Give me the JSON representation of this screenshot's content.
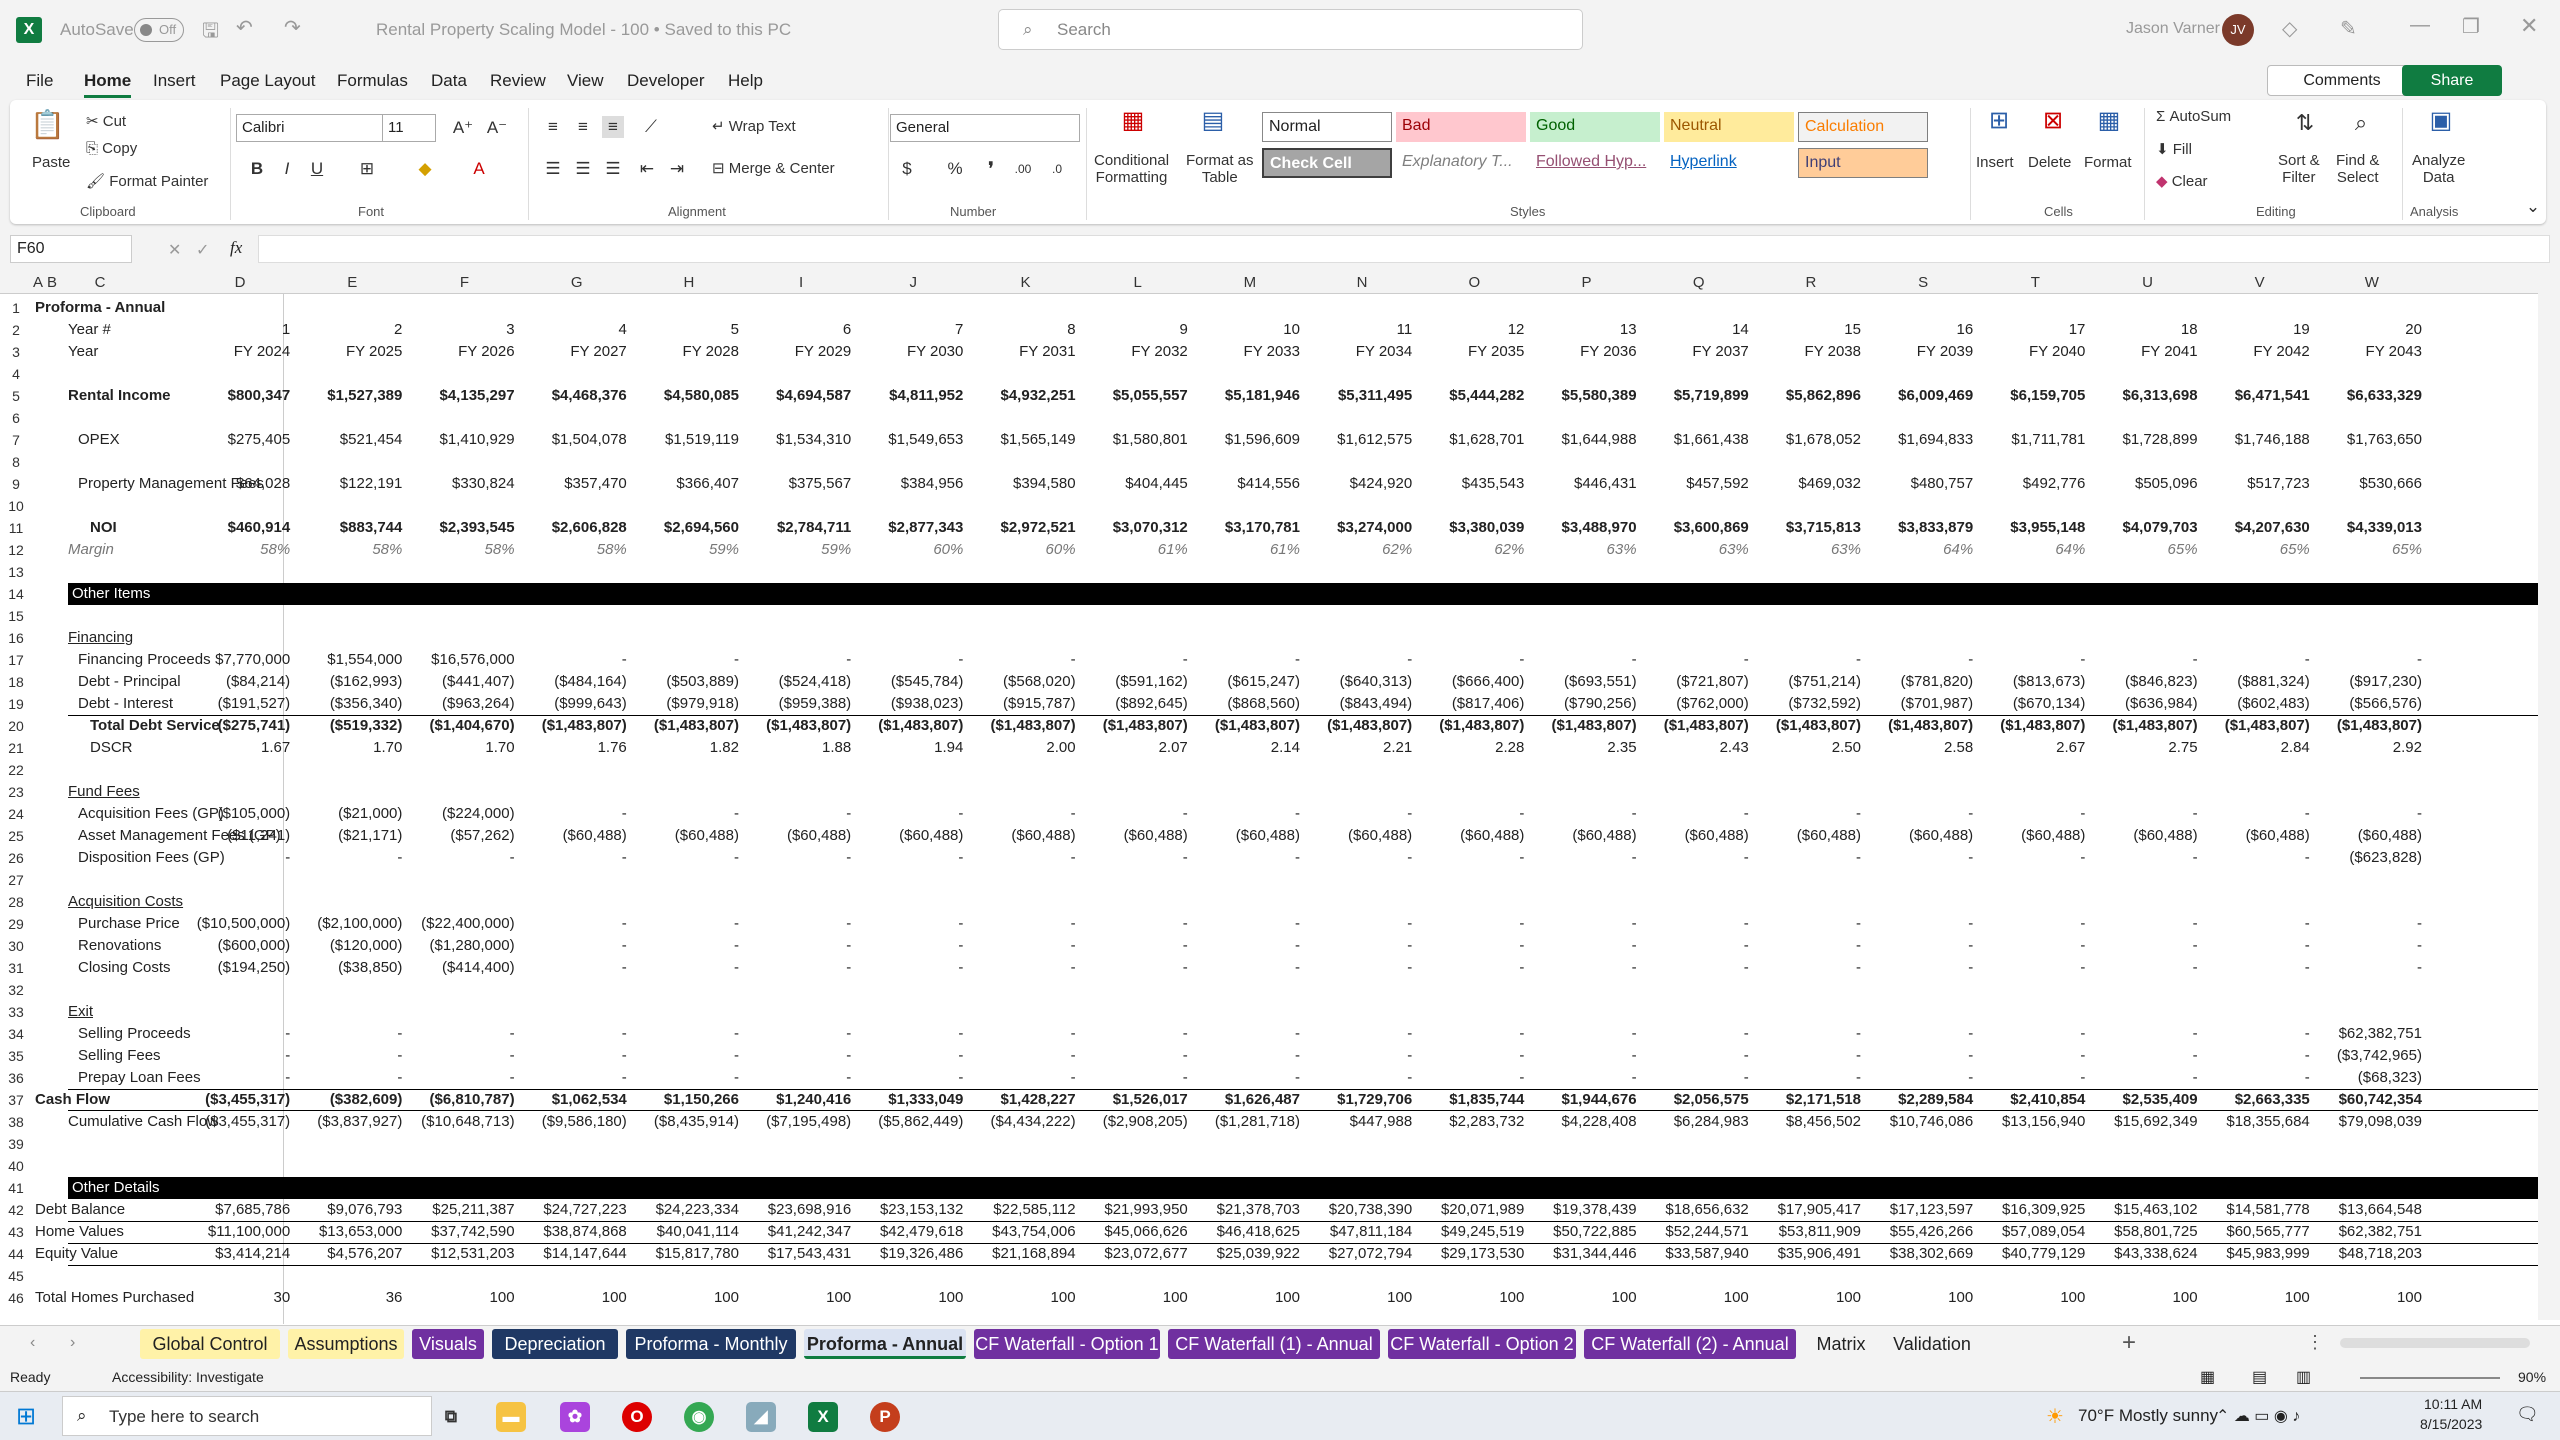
{
  "titlebar": {
    "autosave": "AutoSave",
    "toggle": "Off",
    "doc_title": "Rental Property Scaling Model - 100 • Saved to this PC",
    "search_placeholder": "Search",
    "user_name": "Jason Varner",
    "user_initials": "JV"
  },
  "menu": [
    "File",
    "Home",
    "Insert",
    "Page Layout",
    "Formulas",
    "Data",
    "Review",
    "View",
    "Developer",
    "Help"
  ],
  "menu_active": "Home",
  "comments_label": "Comments",
  "share_label": "Share",
  "ribbon": {
    "paste": "Paste",
    "cut": "Cut",
    "copy": "Copy",
    "format_painter": "Format Painter",
    "clipboard": "Clipboard",
    "font_name": "Calibri",
    "font_size": "11",
    "font": "Font",
    "wrap_text": "Wrap Text",
    "merge_center": "Merge & Center",
    "alignment": "Alignment",
    "number_format": "General",
    "number": "Number",
    "cond_formatting": "Conditional",
    "cond_formatting2": "Formatting",
    "format_table": "Format as",
    "format_table2": "Table",
    "styles": "Styles",
    "style_cells": [
      "Normal",
      "Bad",
      "Good",
      "Neutral",
      "Calculation",
      "Check Cell",
      "Explanatory T...",
      "Followed Hyp...",
      "Hyperlink",
      "Input"
    ],
    "insert": "Insert",
    "delete": "Delete",
    "format": "Format",
    "cells": "Cells",
    "autosum": "AutoSum",
    "fill": "Fill",
    "clear": "Clear",
    "sort_filter": "Sort &",
    "sort_filter2": "Filter",
    "find_select": "Find &",
    "find_select2": "Select",
    "editing": "Editing",
    "analyze": "Analyze",
    "analyze2": "Data",
    "analysis": "Analysis"
  },
  "namebox": "F60",
  "fx": "fx",
  "columns": [
    "A",
    "B",
    "C",
    "D",
    "E",
    "F",
    "G",
    "H",
    "I",
    "J",
    "K",
    "L",
    "M",
    "N",
    "O",
    "P",
    "Q",
    "R",
    "S",
    "T",
    "U",
    "V",
    "W"
  ],
  "rows_numbers": [
    "1",
    "2",
    "3",
    "4",
    "5",
    "6",
    "7",
    "8",
    "9",
    "10",
    "11",
    "12",
    "13",
    "14",
    "15",
    "16",
    "17",
    "18",
    "19",
    "20",
    "21",
    "22",
    "23",
    "24",
    "25",
    "26",
    "27",
    "28",
    "29",
    "30",
    "31",
    "32",
    "33",
    "34",
    "35",
    "36",
    "37",
    "38",
    "39",
    "40",
    "41",
    "42",
    "43",
    "44",
    "45",
    "46"
  ],
  "sheet": {
    "title": "Proforma - Annual",
    "year_label": "Year #",
    "fy_label": "Year",
    "year_nums": [
      "1",
      "2",
      "3",
      "4",
      "5",
      "6",
      "7",
      "8",
      "9",
      "10",
      "11",
      "12",
      "13",
      "14",
      "15",
      "16",
      "17",
      "18",
      "19",
      "20"
    ],
    "fy": [
      "FY 2024",
      "FY 2025",
      "FY 2026",
      "FY 2027",
      "FY 2028",
      "FY 2029",
      "FY 2030",
      "FY 2031",
      "FY 2032",
      "FY 2033",
      "FY 2034",
      "FY 2035",
      "FY 2036",
      "FY 2037",
      "FY 2038",
      "FY 2039",
      "FY 2040",
      "FY 2041",
      "FY 2042",
      "FY 2043"
    ],
    "rows": [
      {
        "r": 5,
        "label": "Rental Income",
        "indent": 1,
        "bold": true,
        "vals": [
          "$800,347",
          "$1,527,389",
          "$4,135,297",
          "$4,468,376",
          "$4,580,085",
          "$4,694,587",
          "$4,811,952",
          "$4,932,251",
          "$5,055,557",
          "$5,181,946",
          "$5,311,495",
          "$5,444,282",
          "$5,580,389",
          "$5,719,899",
          "$5,862,896",
          "$6,009,469",
          "$6,159,705",
          "$6,313,698",
          "$6,471,541",
          "$6,633,329"
        ]
      },
      {
        "r": 7,
        "label": "OPEX",
        "indent": 2,
        "vals": [
          "$275,405",
          "$521,454",
          "$1,410,929",
          "$1,504,078",
          "$1,519,119",
          "$1,534,310",
          "$1,549,653",
          "$1,565,149",
          "$1,580,801",
          "$1,596,609",
          "$1,612,575",
          "$1,628,701",
          "$1,644,988",
          "$1,661,438",
          "$1,678,052",
          "$1,694,833",
          "$1,711,781",
          "$1,728,899",
          "$1,746,188",
          "$1,763,650"
        ]
      },
      {
        "r": 9,
        "label": "Property Management Fees",
        "indent": 2,
        "vals": [
          "$64,028",
          "$122,191",
          "$330,824",
          "$357,470",
          "$366,407",
          "$375,567",
          "$384,956",
          "$394,580",
          "$404,445",
          "$414,556",
          "$424,920",
          "$435,543",
          "$446,431",
          "$457,592",
          "$469,032",
          "$480,757",
          "$492,776",
          "$505,096",
          "$517,723",
          "$530,666"
        ]
      },
      {
        "r": 11,
        "label": "NOI",
        "indent": 3,
        "bold": true,
        "vals": [
          "$460,914",
          "$883,744",
          "$2,393,545",
          "$2,606,828",
          "$2,694,560",
          "$2,784,711",
          "$2,877,343",
          "$2,972,521",
          "$3,070,312",
          "$3,170,781",
          "$3,274,000",
          "$3,380,039",
          "$3,488,970",
          "$3,600,869",
          "$3,715,813",
          "$3,833,879",
          "$3,955,148",
          "$4,079,703",
          "$4,207,630",
          "$4,339,013"
        ]
      },
      {
        "r": 12,
        "label": "Margin",
        "indent": 1,
        "italic": true,
        "vals": [
          "58%",
          "58%",
          "58%",
          "58%",
          "59%",
          "59%",
          "60%",
          "60%",
          "61%",
          "61%",
          "62%",
          "62%",
          "63%",
          "63%",
          "63%",
          "64%",
          "64%",
          "65%",
          "65%",
          "65%"
        ]
      },
      {
        "r": 16,
        "label": "Financing",
        "indent": 1,
        "underline": true,
        "vals": []
      },
      {
        "r": 17,
        "label": "Financing Proceeds",
        "indent": 2,
        "vals": [
          "$7,770,000",
          "$1,554,000",
          "$16,576,000",
          "-",
          "-",
          "-",
          "-",
          "-",
          "-",
          "-",
          "-",
          "-",
          "-",
          "-",
          "-",
          "-",
          "-",
          "-",
          "-",
          "-"
        ]
      },
      {
        "r": 18,
        "label": "Debt - Principal",
        "indent": 2,
        "vals": [
          "($84,214)",
          "($162,993)",
          "($441,407)",
          "($484,164)",
          "($503,889)",
          "($524,418)",
          "($545,784)",
          "($568,020)",
          "($591,162)",
          "($615,247)",
          "($640,313)",
          "($666,400)",
          "($693,551)",
          "($721,807)",
          "($751,214)",
          "($781,820)",
          "($813,673)",
          "($846,823)",
          "($881,324)",
          "($917,230)"
        ]
      },
      {
        "r": 19,
        "label": "Debt - Interest",
        "indent": 2,
        "vals": [
          "($191,527)",
          "($356,340)",
          "($963,264)",
          "($999,643)",
          "($979,918)",
          "($959,388)",
          "($938,023)",
          "($915,787)",
          "($892,645)",
          "($868,560)",
          "($843,494)",
          "($817,406)",
          "($790,256)",
          "($762,000)",
          "($732,592)",
          "($701,987)",
          "($670,134)",
          "($636,984)",
          "($602,483)",
          "($566,576)"
        ]
      },
      {
        "r": 20,
        "label": "Total Debt Service",
        "indent": 3,
        "bold": true,
        "vals": [
          "($275,741)",
          "($519,332)",
          "($1,404,670)",
          "($1,483,807)",
          "($1,483,807)",
          "($1,483,807)",
          "($1,483,807)",
          "($1,483,807)",
          "($1,483,807)",
          "($1,483,807)",
          "($1,483,807)",
          "($1,483,807)",
          "($1,483,807)",
          "($1,483,807)",
          "($1,483,807)",
          "($1,483,807)",
          "($1,483,807)",
          "($1,483,807)",
          "($1,483,807)",
          "($1,483,807)"
        ]
      },
      {
        "r": 21,
        "label": "DSCR",
        "indent": 3,
        "vals": [
          "1.67",
          "1.70",
          "1.70",
          "1.76",
          "1.82",
          "1.88",
          "1.94",
          "2.00",
          "2.07",
          "2.14",
          "2.21",
          "2.28",
          "2.35",
          "2.43",
          "2.50",
          "2.58",
          "2.67",
          "2.75",
          "2.84",
          "2.92"
        ]
      },
      {
        "r": 23,
        "label": "Fund Fees",
        "indent": 1,
        "underline": true,
        "vals": []
      },
      {
        "r": 24,
        "label": "Acquisition Fees (GP)",
        "indent": 2,
        "vals": [
          "($105,000)",
          "($21,000)",
          "($224,000)",
          "-",
          "-",
          "-",
          "-",
          "-",
          "-",
          "-",
          "-",
          "-",
          "-",
          "-",
          "-",
          "-",
          "-",
          "-",
          "-",
          "-"
        ]
      },
      {
        "r": 25,
        "label": "Asset Management Fees (GP)",
        "indent": 2,
        "vals": [
          "($11,241)",
          "($21,171)",
          "($57,262)",
          "($60,488)",
          "($60,488)",
          "($60,488)",
          "($60,488)",
          "($60,488)",
          "($60,488)",
          "($60,488)",
          "($60,488)",
          "($60,488)",
          "($60,488)",
          "($60,488)",
          "($60,488)",
          "($60,488)",
          "($60,488)",
          "($60,488)",
          "($60,488)",
          "($60,488)"
        ]
      },
      {
        "r": 26,
        "label": "Disposition Fees (GP)",
        "indent": 2,
        "vals": [
          "-",
          "-",
          "-",
          "-",
          "-",
          "-",
          "-",
          "-",
          "-",
          "-",
          "-",
          "-",
          "-",
          "-",
          "-",
          "-",
          "-",
          "-",
          "-",
          "($623,828)"
        ]
      },
      {
        "r": 28,
        "label": "Acquisition Costs",
        "indent": 1,
        "underline": true,
        "vals": []
      },
      {
        "r": 29,
        "label": "Purchase Price",
        "indent": 2,
        "vals": [
          "($10,500,000)",
          "($2,100,000)",
          "($22,400,000)",
          "-",
          "-",
          "-",
          "-",
          "-",
          "-",
          "-",
          "-",
          "-",
          "-",
          "-",
          "-",
          "-",
          "-",
          "-",
          "-",
          "-"
        ]
      },
      {
        "r": 30,
        "label": "Renovations",
        "indent": 2,
        "vals": [
          "($600,000)",
          "($120,000)",
          "($1,280,000)",
          "-",
          "-",
          "-",
          "-",
          "-",
          "-",
          "-",
          "-",
          "-",
          "-",
          "-",
          "-",
          "-",
          "-",
          "-",
          "-",
          "-"
        ]
      },
      {
        "r": 31,
        "label": "Closing Costs",
        "indent": 2,
        "vals": [
          "($194,250)",
          "($38,850)",
          "($414,400)",
          "-",
          "-",
          "-",
          "-",
          "-",
          "-",
          "-",
          "-",
          "-",
          "-",
          "-",
          "-",
          "-",
          "-",
          "-",
          "-",
          "-"
        ]
      },
      {
        "r": 33,
        "label": "Exit",
        "indent": 1,
        "underline": true,
        "vals": []
      },
      {
        "r": 34,
        "label": "Selling Proceeds",
        "indent": 2,
        "vals": [
          "-",
          "-",
          "-",
          "-",
          "-",
          "-",
          "-",
          "-",
          "-",
          "-",
          "-",
          "-",
          "-",
          "-",
          "-",
          "-",
          "-",
          "-",
          "-",
          "$62,382,751"
        ]
      },
      {
        "r": 35,
        "label": "Selling Fees",
        "indent": 2,
        "vals": [
          "-",
          "-",
          "-",
          "-",
          "-",
          "-",
          "-",
          "-",
          "-",
          "-",
          "-",
          "-",
          "-",
          "-",
          "-",
          "-",
          "-",
          "-",
          "-",
          "($3,742,965)"
        ]
      },
      {
        "r": 36,
        "label": "Prepay Loan Fees",
        "indent": 2,
        "vals": [
          "-",
          "-",
          "-",
          "-",
          "-",
          "-",
          "-",
          "-",
          "-",
          "-",
          "-",
          "-",
          "-",
          "-",
          "-",
          "-",
          "-",
          "-",
          "-",
          "($68,323)"
        ]
      },
      {
        "r": 37,
        "label": "Cash Flow",
        "indent": 0,
        "bold": true,
        "vals": [
          "($3,455,317)",
          "($382,609)",
          "($6,810,787)",
          "$1,062,534",
          "$1,150,266",
          "$1,240,416",
          "$1,333,049",
          "$1,428,227",
          "$1,526,017",
          "$1,626,487",
          "$1,729,706",
          "$1,835,744",
          "$1,944,676",
          "$2,056,575",
          "$2,171,518",
          "$2,289,584",
          "$2,410,854",
          "$2,535,409",
          "$2,663,335",
          "$60,742,354"
        ]
      },
      {
        "r": 38,
        "label": "Cumulative Cash Flow",
        "indent": 1,
        "vals": [
          "($3,455,317)",
          "($3,837,927)",
          "($10,648,713)",
          "($9,586,180)",
          "($8,435,914)",
          "($7,195,498)",
          "($5,862,449)",
          "($4,434,222)",
          "($2,908,205)",
          "($1,281,718)",
          "$447,988",
          "$2,283,732",
          "$4,228,408",
          "$6,284,983",
          "$8,456,502",
          "$10,746,086",
          "$13,156,940",
          "$15,692,349",
          "$18,355,684",
          "$79,098,039"
        ]
      },
      {
        "r": 42,
        "label": "Debt Balance",
        "indent": 0,
        "vals": [
          "$7,685,786",
          "$9,076,793",
          "$25,211,387",
          "$24,727,223",
          "$24,223,334",
          "$23,698,916",
          "$23,153,132",
          "$22,585,112",
          "$21,993,950",
          "$21,378,703",
          "$20,738,390",
          "$20,071,989",
          "$19,378,439",
          "$18,656,632",
          "$17,905,417",
          "$17,123,597",
          "$16,309,925",
          "$15,463,102",
          "$14,581,778",
          "$13,664,548"
        ]
      },
      {
        "r": 43,
        "label": "Home Values",
        "indent": 0,
        "vals": [
          "$11,100,000",
          "$13,653,000",
          "$37,742,590",
          "$38,874,868",
          "$40,041,114",
          "$41,242,347",
          "$42,479,618",
          "$43,754,006",
          "$45,066,626",
          "$46,418,625",
          "$47,811,184",
          "$49,245,519",
          "$50,722,885",
          "$52,244,571",
          "$53,811,909",
          "$55,426,266",
          "$57,089,054",
          "$58,801,725",
          "$60,565,777",
          "$62,382,751"
        ]
      },
      {
        "r": 44,
        "label": "Equity Value",
        "indent": 0,
        "vals": [
          "$3,414,214",
          "$4,576,207",
          "$12,531,203",
          "$14,147,644",
          "$15,817,780",
          "$17,543,431",
          "$19,326,486",
          "$21,168,894",
          "$23,072,677",
          "$25,039,922",
          "$27,072,794",
          "$29,173,530",
          "$31,344,446",
          "$33,587,940",
          "$35,906,491",
          "$38,302,669",
          "$40,779,129",
          "$43,338,624",
          "$45,983,999",
          "$48,718,203"
        ]
      },
      {
        "r": 46,
        "label": "Total Homes Purchased",
        "indent": 0,
        "vals": [
          "30",
          "36",
          "100",
          "100",
          "100",
          "100",
          "100",
          "100",
          "100",
          "100",
          "100",
          "100",
          "100",
          "100",
          "100",
          "100",
          "100",
          "100",
          "100",
          "100"
        ]
      }
    ],
    "section_other_items": "Other Items",
    "section_other_details": "Other Details"
  },
  "tabs": [
    {
      "label": "Global Control",
      "bg": "#fff2a8",
      "fg": "#222"
    },
    {
      "label": "Assumptions",
      "bg": "#fff2a8",
      "fg": "#222"
    },
    {
      "label": "Visuals",
      "bg": "#7030a0",
      "fg": "#fff"
    },
    {
      "label": "Depreciation",
      "bg": "#1f3864",
      "fg": "#fff"
    },
    {
      "label": "Proforma - Monthly",
      "bg": "#1f3864",
      "fg": "#fff"
    },
    {
      "label": "Proforma - Annual",
      "bg": "#dbe3f2",
      "fg": "#222"
    },
    {
      "label": "CF Waterfall - Option 1",
      "bg": "#7030a0",
      "fg": "#fff"
    },
    {
      "label": "CF Waterfall (1) - Annual",
      "bg": "#7030a0",
      "fg": "#fff"
    },
    {
      "label": "CF Waterfall - Option 2",
      "bg": "#7030a0",
      "fg": "#fff"
    },
    {
      "label": "CF Waterfall (2) - Annual",
      "bg": "#7030a0",
      "fg": "#fff"
    },
    {
      "label": "Matrix",
      "bg": "#f3f3f3",
      "fg": "#222"
    },
    {
      "label": "Validation",
      "bg": "#f3f3f3",
      "fg": "#222"
    }
  ],
  "status": {
    "ready": "Ready",
    "accessibility": "Accessibility: Investigate",
    "zoom": "90%"
  },
  "taskbar": {
    "search": "Type here to search",
    "weather": "70°F  Mostly sunny",
    "time": "10:11 AM",
    "date": "8/15/2023"
  }
}
